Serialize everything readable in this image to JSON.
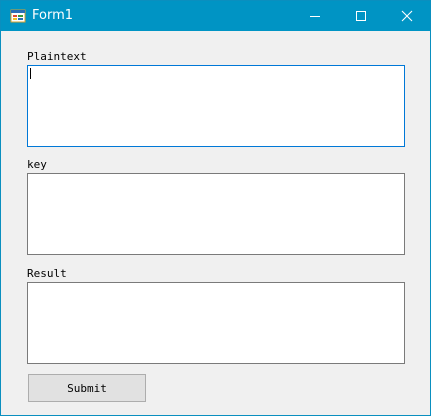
{
  "window": {
    "title": "Form1",
    "icon": "winforms-app-icon",
    "controls": {
      "minimize_icon": "minimize-icon",
      "maximize_icon": "maximize-icon",
      "close_icon": "close-icon"
    }
  },
  "form": {
    "plaintext": {
      "label": "Plaintext",
      "value": ""
    },
    "key": {
      "label": "key",
      "value": ""
    },
    "result": {
      "label": "Result",
      "value": ""
    },
    "submit_label": "Submit"
  },
  "colors": {
    "titlebar": "#0094c4",
    "window_bg": "#f0f0f0",
    "focus_border": "#0078d7",
    "textbox_border": "#7a7a7a",
    "button_bg": "#e1e1e1"
  }
}
